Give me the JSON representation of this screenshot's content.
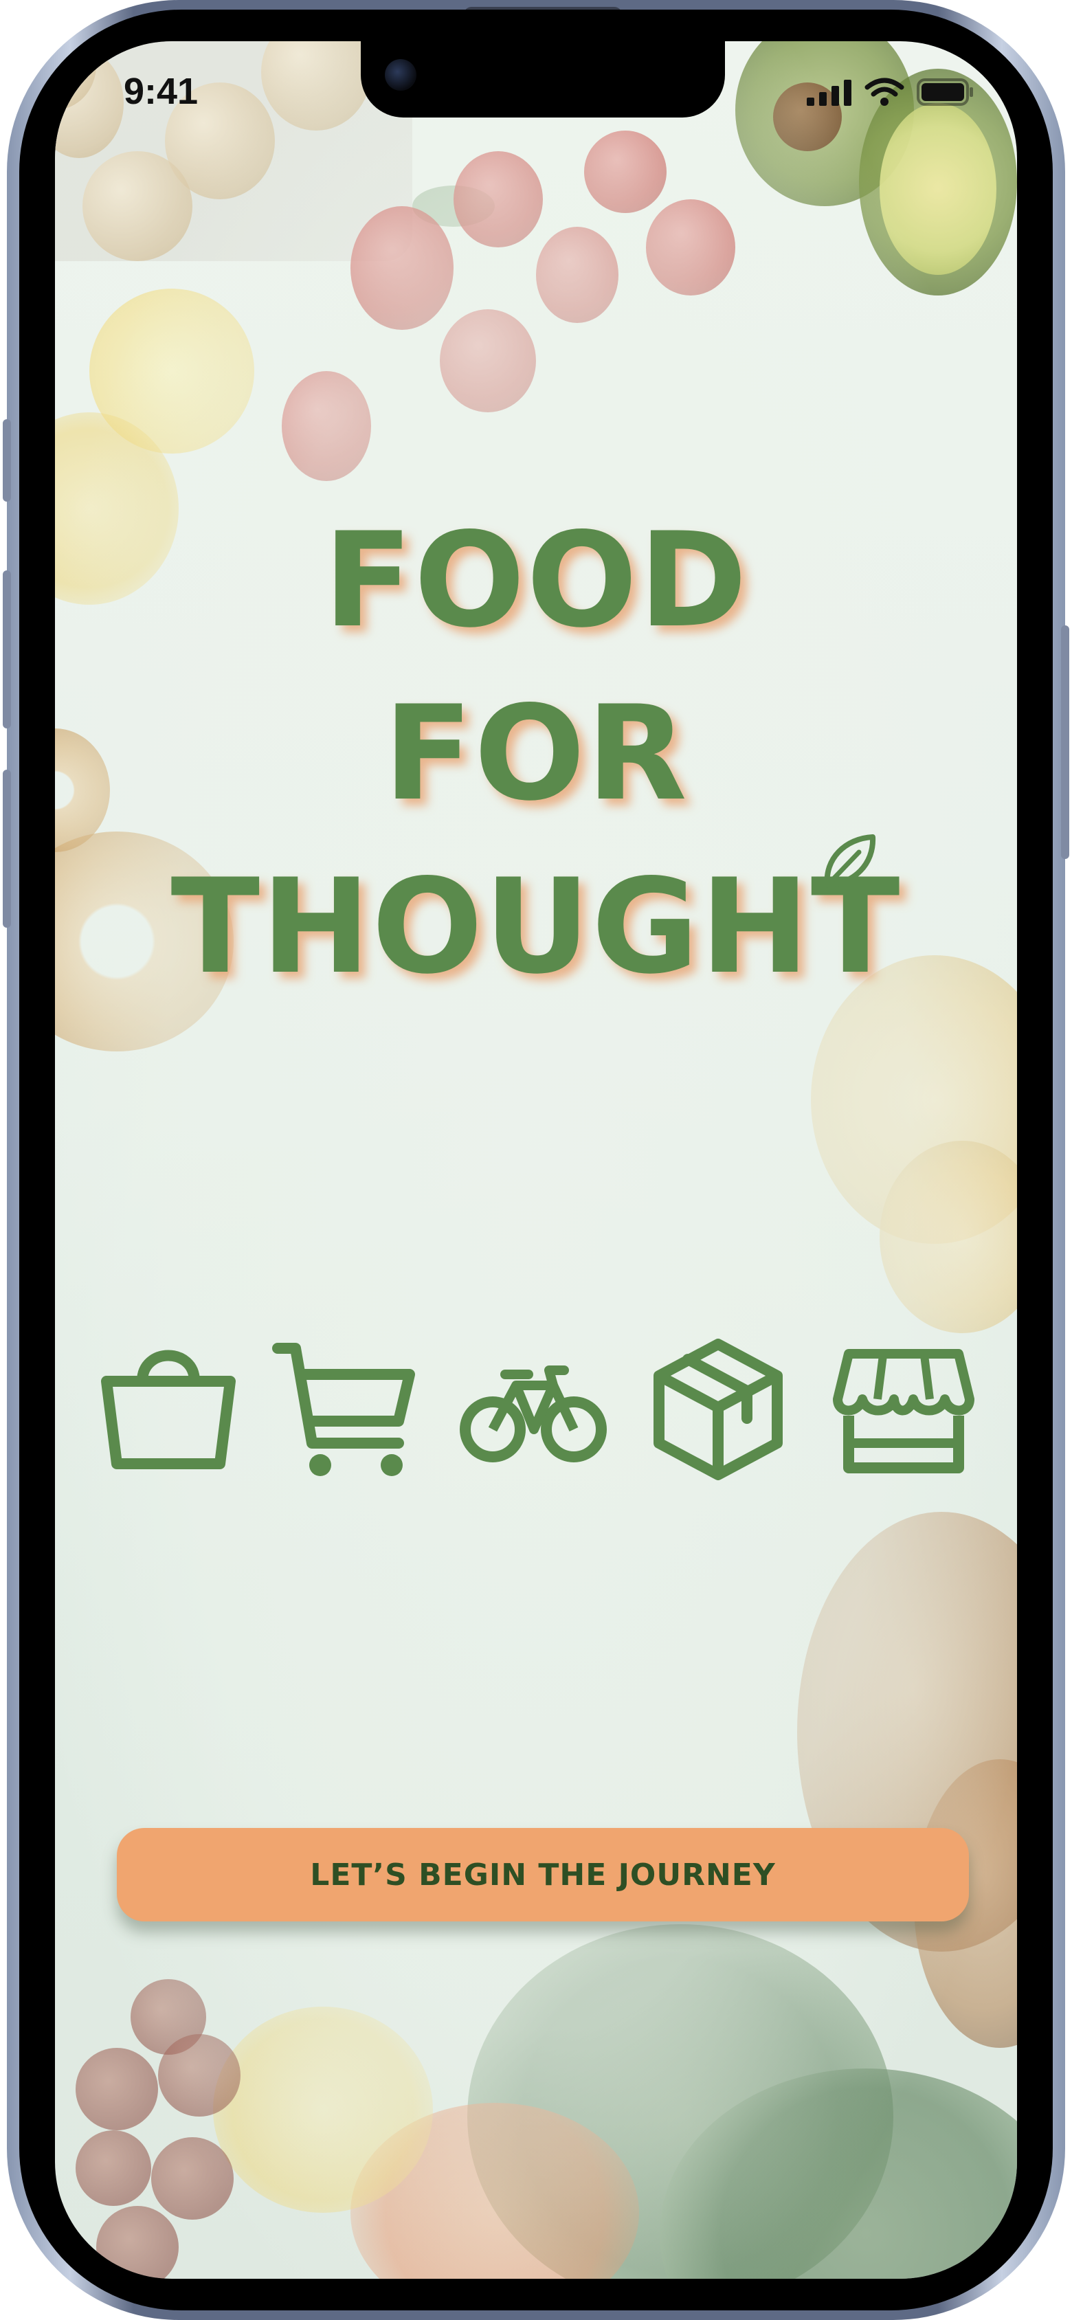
{
  "status_bar": {
    "time": "9:41"
  },
  "brand": {
    "title_line_1": "FOOD",
    "title_line_2": "FOR",
    "title_line_3": "THOUGHT",
    "primary_color": "#5a8a4c",
    "accent_color": "#f0a56f"
  },
  "icons": [
    {
      "name": "shopping-bag-icon"
    },
    {
      "name": "shopping-cart-icon"
    },
    {
      "name": "bicycle-icon"
    },
    {
      "name": "package-box-icon"
    },
    {
      "name": "storefront-icon"
    }
  ],
  "cta": {
    "label": "LET’S BEGIN THE JOURNEY"
  }
}
